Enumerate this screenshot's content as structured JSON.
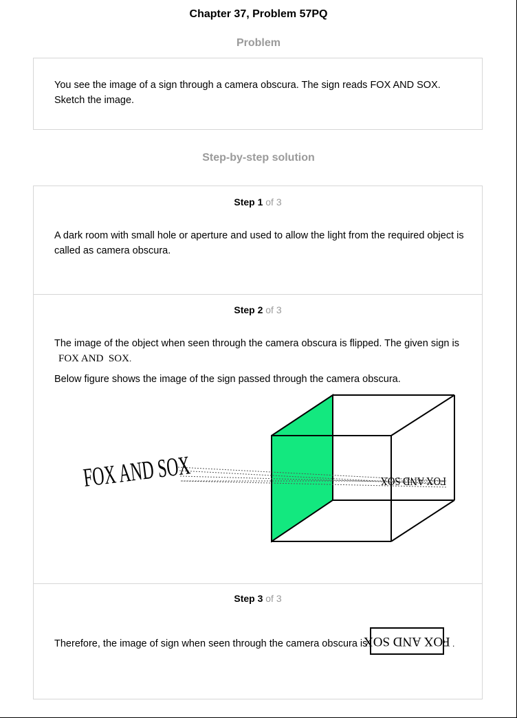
{
  "header": {
    "chapter_title": "Chapter 37, Problem 57PQ",
    "problem_heading": "Problem",
    "solution_heading": "Step-by-step solution"
  },
  "problem": {
    "line1": "You see the image of a sign through a camera obscura. The sign reads FOX AND SOX.",
    "line2": "Sketch the image."
  },
  "steps": [
    {
      "label": "Step 1",
      "of": "of 3",
      "line1": "A dark room with small hole or aperture and used to allow the light from the required object is",
      "line2": "called as camera obscura."
    },
    {
      "label": "Step 2",
      "of": "of 3",
      "line1": "The image of the object when seen through the camera obscura is flipped. The given sign is",
      "sign": "FOX AND  SOX",
      "sign_end": ".",
      "line2": "Below figure shows the image of the sign passed through the camera obscura.",
      "figure": {
        "object_text": "FOX AND SOX",
        "image_text": "FOX AND SOX",
        "screen_color": "#13e87f"
      }
    },
    {
      "label": "Step 3",
      "of": "of 3",
      "line1": "Therefore, the image of sign when seen through the camera obscura is",
      "boxed_text": "FOX AND SOX",
      "end": "."
    }
  ]
}
